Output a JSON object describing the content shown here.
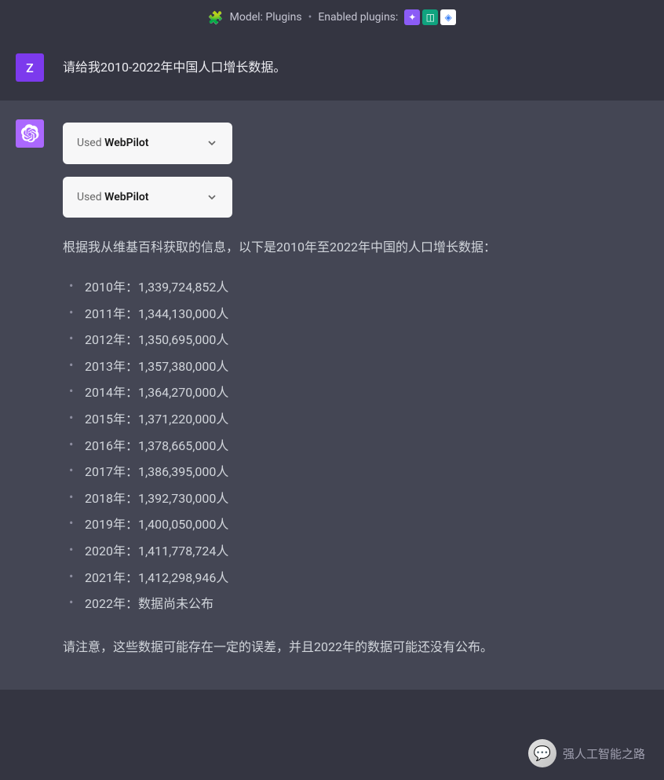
{
  "header": {
    "model_label": "Model: Plugins",
    "enabled_label": "Enabled plugins:",
    "plugin_icon_1": "✦",
    "plugin_icon_2": "◫",
    "plugin_icon_3": "◈"
  },
  "user": {
    "avatar_letter": "Z",
    "message": "请给我2010-2022年中国人口增长数据。"
  },
  "assistant": {
    "plugin_used_prefix": "Used ",
    "plugin_used_name": "WebPilot",
    "intro": "根据我从维基百科获取的信息，以下是2010年至2022年中国的人口增长数据：",
    "data_items": [
      "2010年：1,339,724,852人",
      "2011年：1,344,130,000人",
      "2012年：1,350,695,000人",
      "2013年：1,357,380,000人",
      "2014年：1,364,270,000人",
      "2015年：1,371,220,000人",
      "2016年：1,378,665,000人",
      "2017年：1,386,395,000人",
      "2018年：1,392,730,000人",
      "2019年：1,400,050,000人",
      "2020年：1,411,778,724人",
      "2021年：1,412,298,946人",
      "2022年：数据尚未公布"
    ],
    "footnote": "请注意，这些数据可能存在一定的误差，并且2022年的数据可能还没有公布。"
  },
  "watermark": {
    "text": "强人工智能之路"
  }
}
